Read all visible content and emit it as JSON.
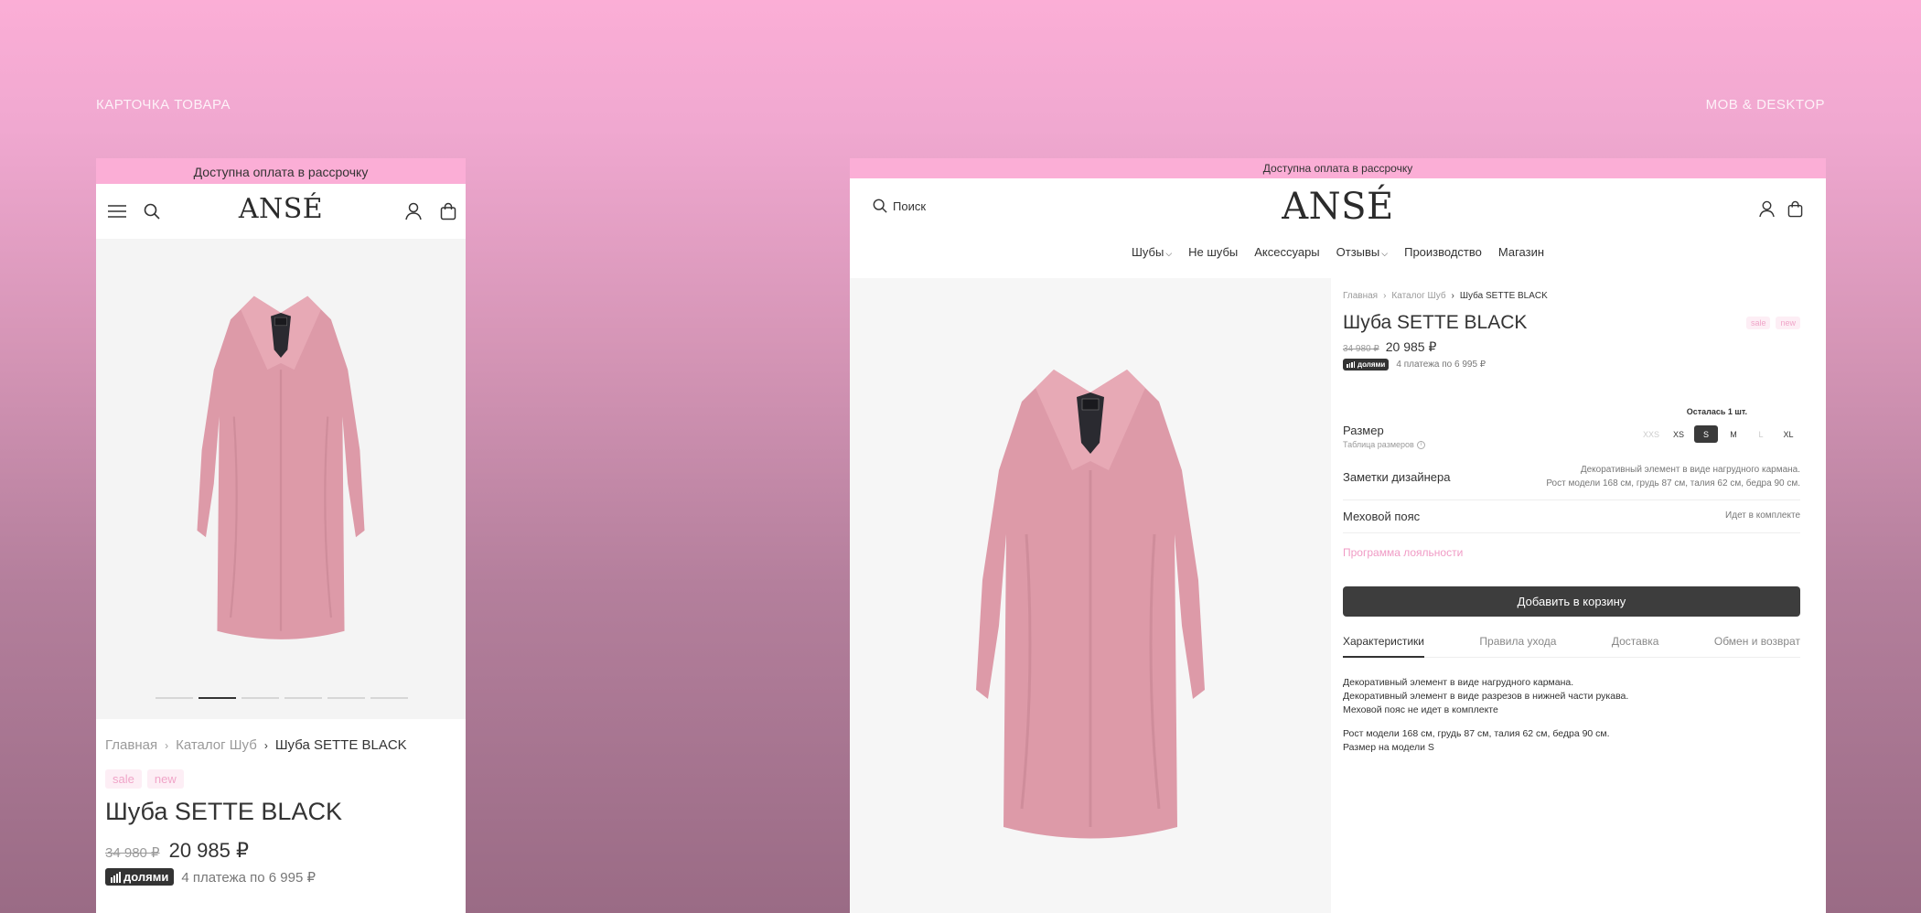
{
  "labels": {
    "left": "КАРТОЧКА ТОВАРА",
    "right": "MOB & DESKTOP"
  },
  "brand": {
    "logo": "ANSÉ",
    "accent": "#fbaed6",
    "dark": "#3d3d3d"
  },
  "promo": "Доступна оплата в рассрочку",
  "search": {
    "label": "Поиск"
  },
  "nav": [
    {
      "label": "Шубы",
      "has_dropdown": true
    },
    {
      "label": "Не шубы",
      "has_dropdown": false
    },
    {
      "label": "Аксессуары",
      "has_dropdown": false
    },
    {
      "label": "Отзывы",
      "has_dropdown": true
    },
    {
      "label": "Производство",
      "has_dropdown": false
    },
    {
      "label": "Магазин",
      "has_dropdown": false
    }
  ],
  "breadcrumbs": [
    "Главная",
    "Каталог Шуб",
    "Шуба SETTE BLACK"
  ],
  "product": {
    "title": "Шуба SETTE BLACK",
    "badges": [
      "sale",
      "new"
    ],
    "old_price": "34 980 ₽",
    "price": "20 985 ₽",
    "dolyami_label": "долями",
    "installments": "4 платежа по 6 995  ₽"
  },
  "gallery": {
    "slide_count": 6,
    "active_slide": 2
  },
  "sizes": {
    "label": "Размер",
    "table_link": "Таблица размеров",
    "tooltip": "Осталась 1 шт.",
    "options": [
      {
        "label": "XXS",
        "state": "disabled"
      },
      {
        "label": "XS",
        "state": "available"
      },
      {
        "label": "S",
        "state": "selected"
      },
      {
        "label": "M",
        "state": "available"
      },
      {
        "label": "L",
        "state": "disabled"
      },
      {
        "label": "XL",
        "state": "available"
      }
    ]
  },
  "designer_notes": {
    "label": "Заметки дизайнера",
    "line1": "Декоративный элемент в виде нагрудного кармана.",
    "line2": "Рост модели 168 см, грудь 87 см, талия 62 см, бедра 90 см."
  },
  "fur_belt": {
    "label": "Меховой пояс",
    "value": "Идет в комплекте"
  },
  "loyalty": "Программа лояльности",
  "add_to_cart": "Добавить в корзину",
  "tabs": [
    "Характеристики",
    "Правила ухода",
    "Доставка",
    "Обмен и возврат"
  ],
  "description": {
    "line1": "Декоративный элемент в виде нагрудного кармана.",
    "line2": "Декоративный элемент в виде разрезов в нижней части рукава.",
    "line3": "Меховой пояс не идет в комплекте",
    "line4": "Рост модели 168 см, грудь 87 см, талия 62 см, бедра 90 см.",
    "line5": "Размер на модели S"
  }
}
